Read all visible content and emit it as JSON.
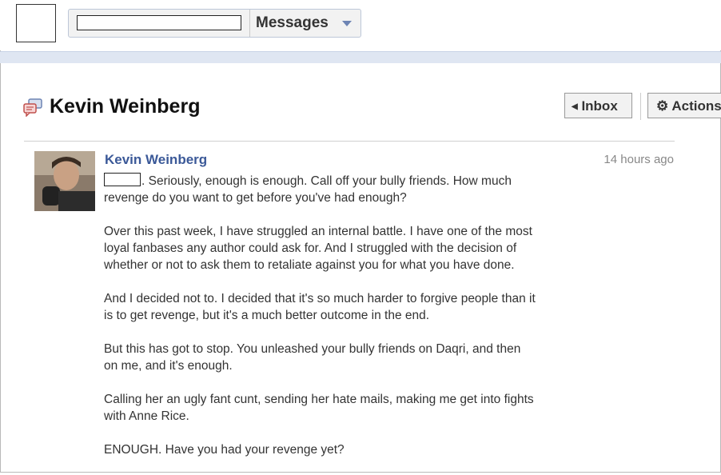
{
  "header": {
    "search": {
      "value": "",
      "placeholder": "",
      "scope_label": "Messages"
    }
  },
  "thread": {
    "title": "Kevin Weinberg",
    "toolbar": {
      "inbox_label": "Inbox",
      "actions_label": "Actions"
    }
  },
  "message": {
    "sender": "Kevin Weinberg",
    "timestamp": "14 hours ago",
    "paragraphs": [
      ". Seriously, enough is enough. Call off your bully friends. How much revenge do you want to get before you've had enough?",
      "Over this past week, I have struggled an internal battle. I have one of the most loyal fanbases any author could ask for. And I struggled with the decision of whether or not to ask them to retaliate against you for what you have done.",
      "And I decided not to. I decided that it's so much harder to forgive people than it is to get revenge, but it's a much better outcome in the end.",
      "But this has got to stop. You unleashed your bully friends on Daqri, and then on me, and it's enough.",
      "Calling her an ugly fant cunt, sending her hate mails, making me get into fights with Anne Rice.",
      "ENOUGH. Have you had your revenge yet?"
    ]
  },
  "colors": {
    "link_blue": "#3b5998",
    "band": "#dfe6f2",
    "accent": "#6d84b4"
  },
  "icons": {
    "thread": "message-thread-icon",
    "inbox": "left-arrow-icon",
    "actions": "gear-icon",
    "scope": "dropdown-arrow-icon"
  }
}
